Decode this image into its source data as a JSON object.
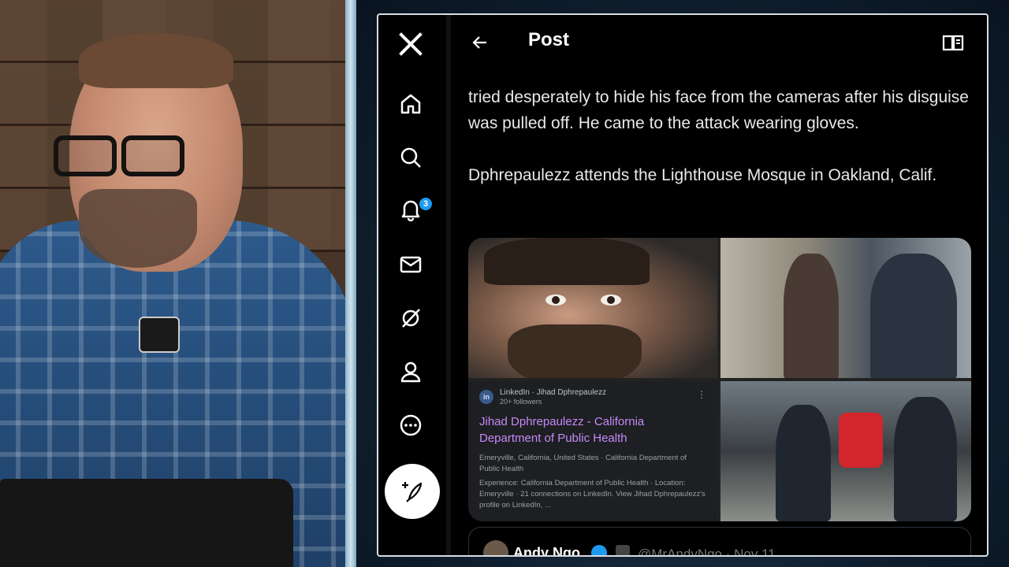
{
  "sidebar": {
    "items": [
      {
        "name": "x-logo-icon"
      },
      {
        "name": "home-icon"
      },
      {
        "name": "search-icon"
      },
      {
        "name": "bell-icon",
        "badge": "3"
      },
      {
        "name": "mail-icon"
      },
      {
        "name": "grok-icon"
      },
      {
        "name": "profile-icon"
      },
      {
        "name": "more-icon"
      }
    ],
    "compose_icon": "feather-plus-icon"
  },
  "header": {
    "title": "Post"
  },
  "post": {
    "paragraph1": "tried desperately to hide his face from the cameras after his disguise was pulled off. He came to the attack wearing gloves.",
    "paragraph2": "Dphrepaulezz attends the Lighthouse Mosque in Oakland, Calif."
  },
  "linkedin_card": {
    "logo": "in",
    "source": "LinkedIn · Jihad Dphrepaulezz",
    "followers": "20+ followers",
    "title": "Jihad Dphrepaulezz - California Department of Public Health",
    "location": "Emeryville, California, United States · California Department of Public Health",
    "details": "Experience: California Department of Public Health · Location: Emeryville · 21 connections on LinkedIn. View Jihad Dphrepaulezz's profile on LinkedIn, ..."
  },
  "next_post": {
    "name": "Andy Ngo",
    "handle": "@MrAndyNgo · Nov 11"
  },
  "colors": {
    "accent": "#1d9bf0",
    "link_purple": "#c58af9"
  }
}
